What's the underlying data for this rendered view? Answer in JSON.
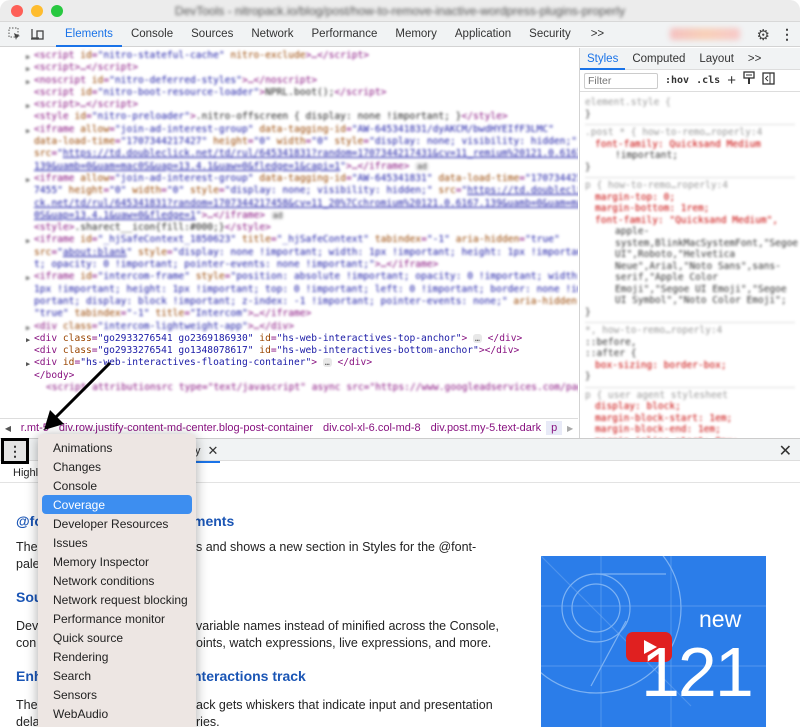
{
  "window": {
    "title": "DevTools - nitropack.io/blog/post/how-to-remove-inactive-wordpress-plugins-properly",
    "traffic_lights": [
      "#fe5f57",
      "#febc2e",
      "#28c840"
    ]
  },
  "toolbar": {
    "tabs": [
      "Elements",
      "Console",
      "Sources",
      "Network",
      "Performance",
      "Memory",
      "Application",
      "Security"
    ],
    "active_tab": "Elements",
    "more_label": ">>"
  },
  "dom": {
    "lines": [
      {
        "tri": true,
        "html": "<span class='t'>&lt;script</span> <span class='a'>id</span>=<span class='v'>\"nitro-stateful-cache\"</span> <span class='a'>nitro-exclude</span><span class='t'>&gt;</span>…<span class='t'>&lt;/script&gt;</span>"
      },
      {
        "tri": true,
        "html": "<span class='t'>&lt;script&gt;</span>…<span class='t'>&lt;/script&gt;</span>"
      },
      {
        "tri": true,
        "html": "<span class='t'>&lt;noscript</span> <span class='a'>id</span>=<span class='v'>\"nitro-deferred-styles\"</span><span class='t'>&gt;</span>…<span class='t'>&lt;/noscript&gt;</span>"
      },
      {
        "tri": false,
        "html": "<span class='t'>&lt;script</span> <span class='a'>id</span>=<span class='v'>\"nitro-boot-resource-loader\"</span><span class='t'>&gt;</span><span class='x'>NPRL.boot();</span><span class='t'>&lt;/script&gt;</span>"
      },
      {
        "tri": true,
        "html": "<span class='t'>&lt;script&gt;</span>…<span class='t'>&lt;/script&gt;</span>"
      },
      {
        "tri": false,
        "html": "<span class='t'>&lt;style</span> <span class='a'>id</span>=<span class='v'>\"nitro-preloader\"</span><span class='t'>&gt;</span><span class='x'>.nitro-offscreen { display: none !important; }</span><span class='t'>&lt;/style&gt;</span>"
      },
      {
        "tri": true,
        "html": "<span class='t'>&lt;iframe</span> <span class='a'>allow</span>=<span class='v'>\"join-ad-interest-group\"</span> <span class='a'>data-tagging-id</span>=<span class='v'>\"AW-645341831/dyAKCM/bwdHYEIfF3LMC\"</span>"
      },
      {
        "tri": false,
        "html": "<span class='a'>data-load-time</span>=<span class='v'>\"1707344217427\"</span> <span class='a'>height</span>=<span class='v'>\"0\"</span> <span class='a'>width</span>=<span class='v'>\"0\"</span> <span class='a'>style</span>=<span class='v'>\"display: none; visibility: hidden;\"</span>"
      },
      {
        "tri": false,
        "html": "<span class='a'>src</span>=<span class='v'>\"</span><span class='u'>https://td.doubleclick.net/td/rul/645341831?random=1707344217431&amp;cv=11_remium%20121.0.6167.</span>"
      },
      {
        "tri": false,
        "html": "<span class='u'>139&amp;uamb=0&amp;uam=mac0S&amp;uap=13.4.1&amp;uaw=0&amp;fledge=1&amp;capi=1</span><span class='v'>\"</span><span class='t'>&gt;</span>…<span class='t'>&lt;/iframe&gt;</span> <span class='dots'>ad</span>"
      },
      {
        "tri": true,
        "html": "<span class='t'>&lt;iframe</span> <span class='a'>allow</span>=<span class='v'>\"join-ad-interest-group\"</span> <span class='a'>data-tagging-id</span>=<span class='v'>\"AW-645341831\"</span> <span class='a'>data-load-time</span>=<span class='v'>\"170734421</span>"
      },
      {
        "tri": false,
        "html": "<span class='v'>7455\"</span> <span class='a'>height</span>=<span class='v'>\"0\"</span> <span class='a'>width</span>=<span class='v'>\"0\"</span> <span class='a'>style</span>=<span class='v'>\"display: none; visibility: hidden;\"</span> <span class='a'>src</span>=<span class='v'>\"</span><span class='u'>https://td.doublecli</span>"
      },
      {
        "tri": false,
        "html": "<span class='u'>ck.net/td/rul/645341831?random=1707344217458&amp;cv=11_20%7Cchromium%20121.0.6167.139&amp;uamb=0&amp;uam=mac</span>"
      },
      {
        "tri": false,
        "html": "<span class='u'>0S&amp;uap=13.4.1&amp;uaw=0&amp;fledge=1</span><span class='v'>\"</span><span class='t'>&gt;</span>…<span class='t'>&lt;/iframe&gt;</span> <span class='dots'>ad</span>"
      },
      {
        "tri": false,
        "html": "<span class='t'>&lt;style&gt;</span><span class='x'>.sharect__icon{fill:#000;}</span><span class='t'>&lt;/style&gt;</span>"
      },
      {
        "tri": true,
        "html": "<span class='t'>&lt;iframe</span> <span class='a'>id</span>=<span class='v'>\"_hjSafeContext_1850623\"</span> <span class='a'>title</span>=<span class='v'>\"_hjSafeContext\"</span> <span class='a'>tabindex</span>=<span class='v'>\"-1\"</span> <span class='a'>aria-hidden</span>=<span class='v'>\"true\"</span>"
      },
      {
        "tri": false,
        "html": "<span class='a'>src</span>=<span class='v'>\"</span><span class='u'>about:blank</span><span class='v'>\"</span> <span class='a'>style</span>=<span class='v'>\"display: none !important; width: 1px !important; height: 1px !importan</span>"
      },
      {
        "tri": false,
        "html": "<span class='v'>t; opacity: 0 !important; pointer-events: none !important;\"</span><span class='t'>&gt;</span>…<span class='t'>&lt;/iframe&gt;</span>"
      },
      {
        "tri": true,
        "html": "<span class='t'>&lt;iframe</span> <span class='a'>id</span>=<span class='v'>\"intercom-frame\"</span> <span class='a'>style</span>=<span class='v'>\"position: absolute !important; opacity: 0 !important; width:</span>"
      },
      {
        "tri": false,
        "html": "<span class='v'>1px !important; height: 1px !important; top: 0 !important; left: 0 !important; border: none !im</span>"
      },
      {
        "tri": false,
        "html": "<span class='v'>portant; display: block !important; z-index: -1 !important; pointer-events: none;\"</span> <span class='a'>aria-hidden</span>"
      },
      {
        "tri": false,
        "html": "<span class='v'>\"true\"</span> <span class='a'>tabindex</span>=<span class='v'>\"-1\"</span> <span class='a'>title</span>=<span class='v'>\"Intercom\"</span><span class='t'>&gt;</span>…<span class='t'>&lt;/iframe&gt;</span>"
      },
      {
        "tri": true,
        "html": "<span class='t'>&lt;div</span> <span class='a'>class</span>=<span class='v'>\"intercom-lightweight-app\"</span><span class='t'>&gt;</span>…<span class='t'>&lt;/div&gt;</span>"
      }
    ],
    "clear_lines": [
      {
        "tri": true,
        "tag_open": "<div ",
        "attr1": "class",
        "val1": "\"go2933276541 go2369186930\"",
        "attr2": "id",
        "val2": "\"hs-web-interactives-top-anchor\"",
        "tail": "> ",
        "dots": true,
        "close": " </div>"
      },
      {
        "tri": false,
        "tag_open": "<div ",
        "attr1": "class",
        "val1": "\"go2933276541 go1348078617\"",
        "attr2": "id",
        "val2": "\"hs-web-interactives-bottom-anchor\"",
        "tail": ">",
        "dots": false,
        "close": "</div>"
      },
      {
        "tri": true,
        "tag_open": "<div ",
        "attr1": "id",
        "val1": "\"hs-web-interactives-floating-container\"",
        "attr2": "",
        "val2": "",
        "tail": "> ",
        "dots": true,
        "close": " </div>"
      }
    ],
    "body_close": "</body>",
    "partial_line": "<script attributionsrc type=\"text/javascript\" async src=\"https://www.googleadservices.com/pagead/"
  },
  "breadcrumb": {
    "items": [
      "r.mt-5",
      "div.row.justify-content-md-center.blog-post-container",
      "div.col-xl-6.col-md-8",
      "div.post.my-5.text-dark",
      "p"
    ],
    "selected": "p"
  },
  "styles": {
    "tabs": [
      "Styles",
      "Computed",
      "Layout",
      ">>"
    ],
    "active_tab": "Styles",
    "filter_placeholder": "Filter",
    "hov_label": ":hov",
    "cls_label": ".cls",
    "rules_blurred": [
      [
        "element.style {",
        "}"
      ],
      [
        ".post * {   how-to-remo…roperly:4",
        "font-family: Quicksand Medium",
        "  !important;",
        "}"
      ],
      [
        "p {   how-to-remo…roperly:4",
        "margin-top: 0;",
        "margin-bottom: 1rem;",
        "font-family: \"Quicksand Medium\",",
        "  apple-system,BlinkMacSystemFont,\"Segoe",
        "  UI\",Roboto,\"Helvetica",
        "  Neue\",Arial,\"Noto Sans\",sans-",
        "  serif,\"Apple Color",
        "  Emoji\",\"Segoe UI Emoji\",\"Segoe",
        "  UI Symbol\",\"Noto Color Emoji\";",
        "}"
      ],
      [
        "*,   how-to-remo…roperly:4",
        "::before,",
        "::after {",
        "box-sizing: border-box;",
        "}"
      ],
      [
        "p {   user agent stylesheet",
        "display: block;",
        "margin-block-start: 1em;",
        "margin-block-end: 1em;",
        "margin-inline-start: 0px;"
      ]
    ]
  },
  "drawer": {
    "tab_label": "y",
    "sub_label": "Highli",
    "headings": [
      "@fo",
      "Sou",
      "Enh"
    ],
    "heading_tails": [
      "ments",
      "",
      "nteractions track"
    ],
    "para1_left": [
      "The",
      "pale"
    ],
    "para1_right": "s and shows a new section in Styles for the @font-",
    "para2_left": [
      "Dev",
      "con"
    ],
    "para2_right": [
      "variable names instead of minified across the Console,",
      "oints, watch expressions, live expressions, and more."
    ],
    "para3_left": [
      "The",
      "dela"
    ],
    "para3_right": [
      "ack gets whiskers that indicate input and presentation",
      "ries."
    ],
    "thumbnail": {
      "line1": "new",
      "line2": "121",
      "bg": "#2b7de9"
    }
  },
  "more_tools_menu": {
    "items": [
      "Animations",
      "Changes",
      "Console",
      "Coverage",
      "Developer Resources",
      "Issues",
      "Memory Inspector",
      "Network conditions",
      "Network request blocking",
      "Performance monitor",
      "Quick source",
      "Rendering",
      "Search",
      "Sensors",
      "WebAudio"
    ],
    "highlighted": "Coverage",
    "highlight_color": "#3d8ef0"
  }
}
